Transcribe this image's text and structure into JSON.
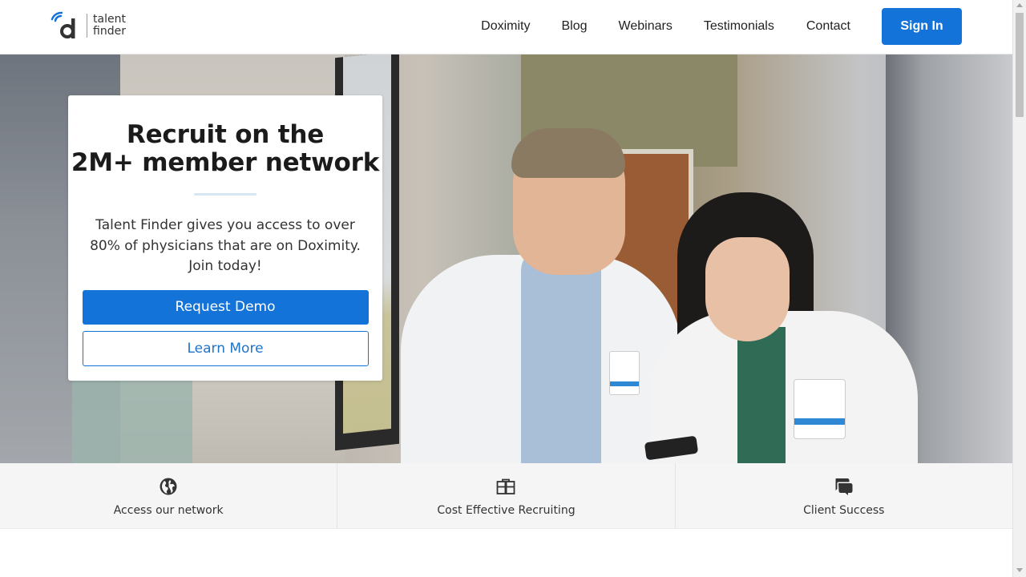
{
  "header": {
    "logo": {
      "brand": "talent finder",
      "line1": "talent",
      "line2": "finder"
    },
    "nav": [
      "Doximity",
      "Blog",
      "Webinars",
      "Testimonials",
      "Contact"
    ],
    "signin_label": "Sign In"
  },
  "hero": {
    "title_line1": "Recruit on the",
    "title_line2": "2M+ member network",
    "description": "Talent Finder gives you access to over 80% of physicians that are on Doximity. Join today!",
    "primary_button": "Request Demo",
    "secondary_button": "Learn More"
  },
  "features": [
    {
      "label": "Access our network",
      "icon": "globe-icon"
    },
    {
      "label": "Cost Effective Recruiting",
      "icon": "briefcase-icon"
    },
    {
      "label": "Client Success",
      "icon": "chat-bubbles-icon"
    }
  ],
  "colors": {
    "primary": "#1473d8",
    "feature_bg": "#f5f5f5"
  }
}
